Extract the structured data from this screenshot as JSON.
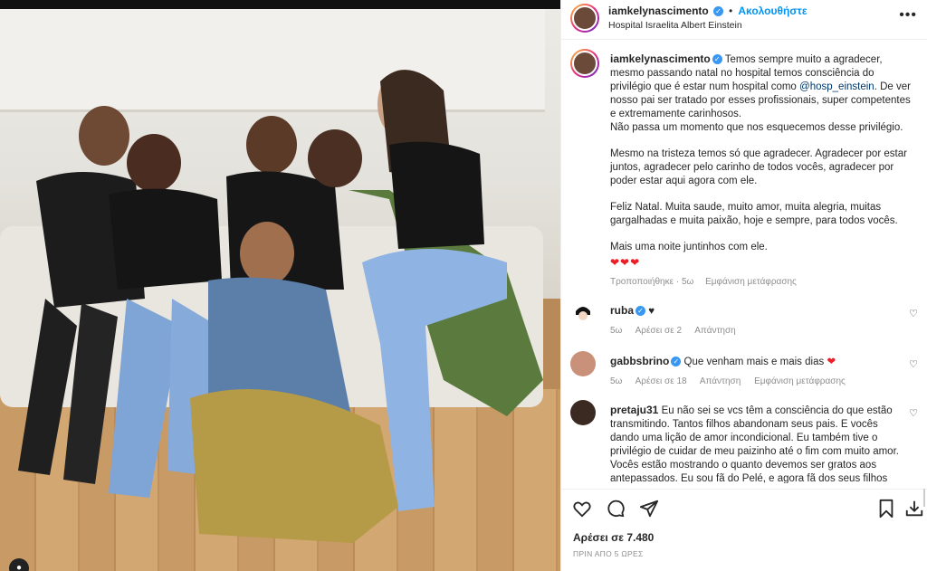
{
  "post": {
    "username": "iamkelynascimento",
    "follow_label": "Ακολουθήστε",
    "location": "Hospital Israelita Albert Einstein"
  },
  "caption": {
    "username": "iamkelynascimento",
    "p1_a": "Temos sempre muito a agradecer, mesmo passando natal no hospital temos consciência do privilégio que é estar num hospital como",
    "p1_mention": "@hosp_einstein",
    "p1_b": ". De ver nosso pai ser tratado por esses profissionais, super competentes e extremamente carinhosos.",
    "p1_c": "Não passa um momento que nos esquecemos desse privilégio.",
    "p2": "Mesmo na tristeza temos só que agradecer. Agradecer por estar juntos, agradecer pelo carinho de todos vocês, agradecer por poder estar aqui agora com ele.",
    "p3": "Feliz Natal. Muita saude, muito amor, muita alegria, muitas gargalhadas e muita paixão, hoje e sempre, para todos vocês.",
    "p4": "Mais uma noite juntinhos com ele.",
    "hearts": "❤❤❤",
    "edited": "Τροποποιήθηκε · 5ω",
    "translate": "Εμφάνιση μετάφρασης"
  },
  "comments": [
    {
      "username": "ruba",
      "text": "♥",
      "time": "5ω",
      "likes": "Αρέσει σε 2",
      "reply": "Απάντηση",
      "translate": ""
    },
    {
      "username": "gabbsbrino",
      "text": "Que venham mais e mais dias",
      "time": "5ω",
      "likes": "Αρέσει σε 18",
      "reply": "Απάντηση",
      "translate": "Εμφάνιση μετάφρασης"
    },
    {
      "username": "pretaju31",
      "text": "Eu não sei se vcs têm a consciência do que estão transmitindo. Tantos filhos abandonam seus pais. E vocês dando uma lição de amor incondicional. Eu também tive o privilégio de cuidar de meu paizinho até o fim com muito amor. Vocês estão mostrando o quanto devemos ser gratos aos antepassados. Eu sou fã do Pelé, e agora fã dos seus filhos"
    }
  ],
  "footer": {
    "likes": "Αρέσει σε 7.480",
    "time": "ΠΡΙΝ ΑΠΟ 5 ΩΡΕΣ"
  },
  "icons": {
    "more": "more-options-icon",
    "like": "heart-icon",
    "comment": "comment-icon",
    "share": "share-icon",
    "save": "bookmark-icon",
    "download": "download-icon",
    "verified": "verified-badge-icon"
  },
  "colors": {
    "accent": "#0095f6",
    "verified": "#3897f0",
    "heart": "#ed1d25",
    "muted": "#8e8e8e",
    "mention": "#00376b"
  }
}
